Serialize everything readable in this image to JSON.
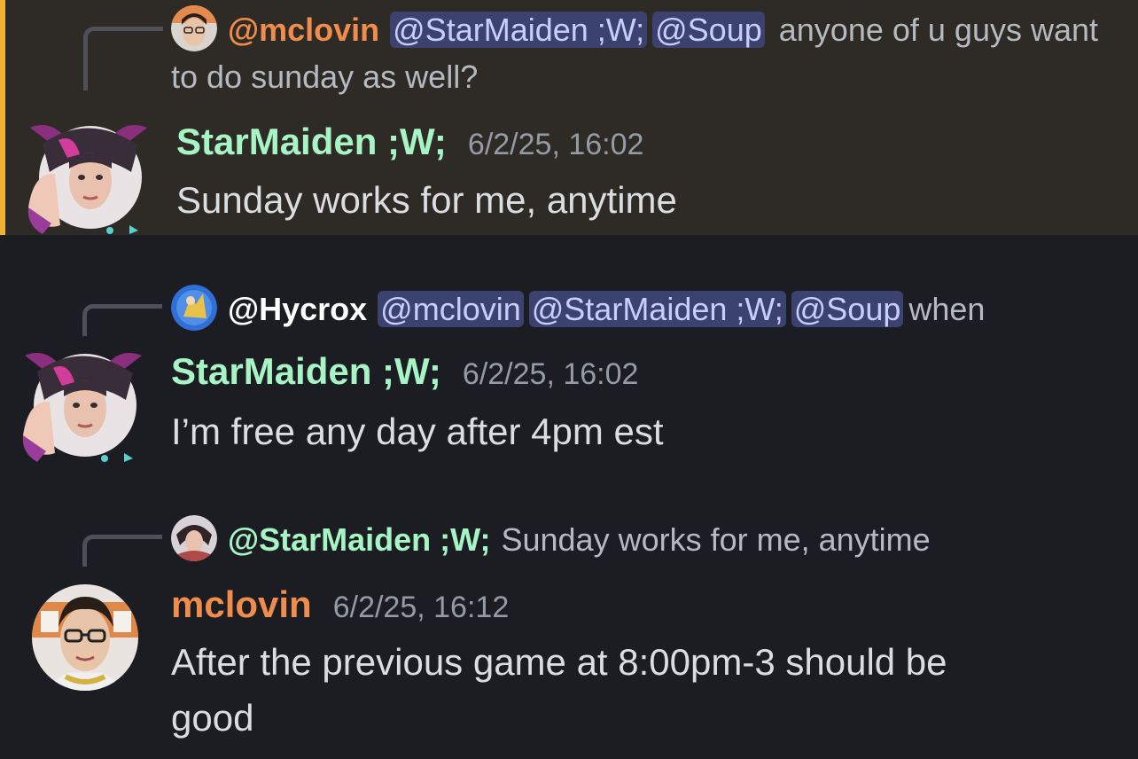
{
  "colors": {
    "background": "#1c1d22",
    "highlight_background": "#2e2b26",
    "highlight_bar": "#f0b232",
    "starmaiden_name": "#a7f5c4",
    "mclovin_name": "#f08c4c",
    "hycrox_name": "#ffffff",
    "mention_bg": "#3c4270",
    "mention_text": "#c9cdfb"
  },
  "messages": [
    {
      "highlighted": true,
      "reply": {
        "author": "@mclovin",
        "mentions": [
          "@StarMaiden ;W;",
          "@Soup"
        ],
        "text": "anyone of u guys want to do sunday as well?"
      },
      "author": "StarMaiden ;W;",
      "timestamp": "6/2/25, 16:02",
      "content": "Sunday works for me, anytime"
    },
    {
      "highlighted": false,
      "reply": {
        "author": "@Hycrox",
        "mentions": [
          "@mclovin",
          "@StarMaiden ;W;",
          "@Soup"
        ],
        "text": "when"
      },
      "author": "StarMaiden ;W;",
      "timestamp": "6/2/25, 16:02",
      "content": "I’m free any day after 4pm est"
    },
    {
      "highlighted": false,
      "reply": {
        "author": "@StarMaiden ;W;",
        "mentions": [],
        "text": "Sunday works for me, anytime"
      },
      "author": "mclovin",
      "timestamp": "6/2/25, 16:12",
      "content": "After the previous game at 8:00pm-3 should be good"
    }
  ]
}
